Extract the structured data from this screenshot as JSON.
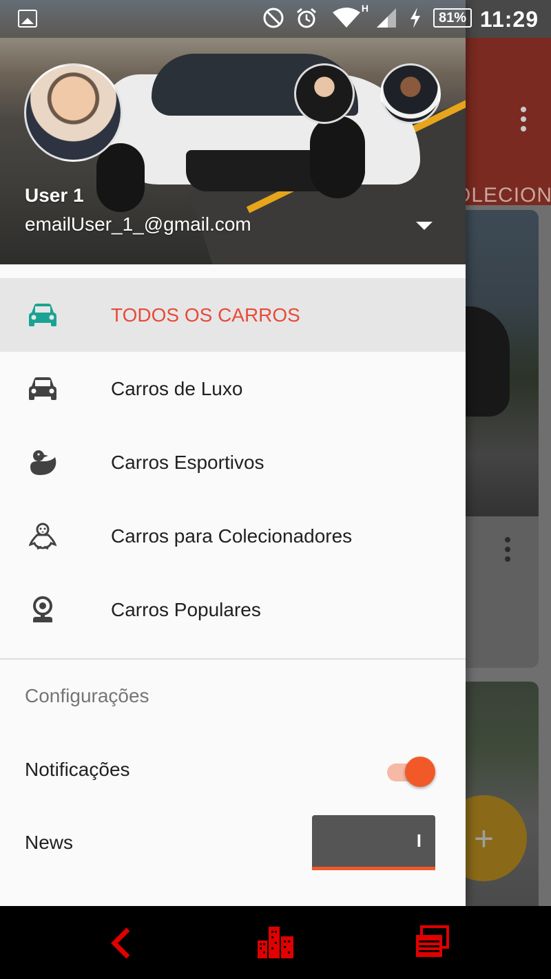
{
  "status_bar": {
    "battery": "81%",
    "network_type": "H",
    "time": "11:29",
    "icons": [
      "gallery-icon",
      "do-not-disturb-icon",
      "alarm-icon",
      "wifi-icon",
      "signal-icon",
      "charging-icon",
      "battery-icon"
    ]
  },
  "background_app": {
    "tab_partial": "OLECION",
    "fab_label": "+",
    "toolbar_color": "#7a2a20"
  },
  "drawer": {
    "header": {
      "user_name": "User 1",
      "user_email": "emailUser_1_@gmail.com"
    },
    "nav_items": [
      {
        "label": "TODOS OS CARROS",
        "icon": "car-icon",
        "active": true
      },
      {
        "label": "Carros de Luxo",
        "icon": "car-icon",
        "active": false
      },
      {
        "label": "Carros Esportivos",
        "icon": "duck-icon",
        "active": false
      },
      {
        "label": "Carros para Colecionadores",
        "icon": "penguin-icon",
        "active": false
      },
      {
        "label": "Carros Populares",
        "icon": "webcam-icon",
        "active": false
      }
    ],
    "settings": {
      "title": "Configurações",
      "notifications_label": "Notificações",
      "notifications_on": true,
      "news_label": "News",
      "news_toggle_text": "I"
    },
    "colors": {
      "active_text": "#e84a3a",
      "active_icon": "#1aa394",
      "accent": "#f15a28"
    }
  },
  "system_nav": {
    "buttons": [
      "back-icon",
      "home-icon",
      "recent-apps-icon"
    ],
    "color": "#e00000"
  }
}
